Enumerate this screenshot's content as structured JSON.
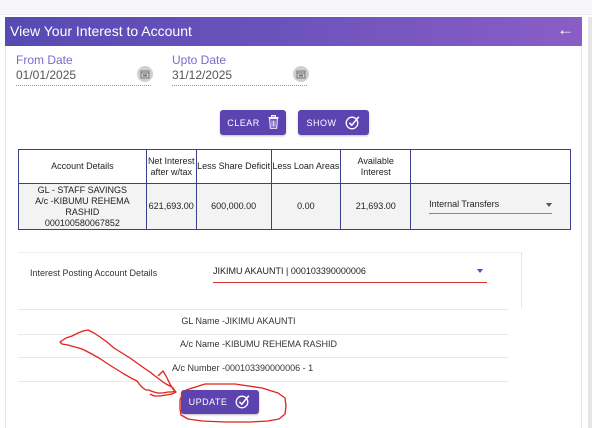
{
  "header": {
    "title": "View Your Interest to Account",
    "back_icon": "arrow-left-icon"
  },
  "filters": {
    "from_label": "From Date",
    "from_value": "01/01/2025",
    "upto_label": "Upto Date",
    "upto_value": "31/12/2025"
  },
  "actions": {
    "clear_label": "CLEAR",
    "show_label": "SHOW",
    "update_label": "UPDATE"
  },
  "table": {
    "headers": [
      "Account Details",
      "Net Interest after w/tax",
      "Less Share Deficit",
      "Less Loan Areas",
      "Available Interest",
      ""
    ],
    "row": {
      "account_line1": "GL - STAFF SAVINGS",
      "account_line2": "A/c -KIBUMU REHEMA RASHID",
      "account_line3": "000100580067852",
      "net_interest": "621,693.00",
      "share_deficit": "600,000.00",
      "loan_areas": "0.00",
      "available_interest": "21,693.00",
      "transfer_type": "Internal Transfers"
    }
  },
  "posting": {
    "label": "Interest Posting Account Details",
    "selected": "JIKIMU AKAUNTI | 000103390000006"
  },
  "details": {
    "gl_name_label": "GL Name -",
    "gl_name_value": "JIKIMU AKAUNTI",
    "ac_name_label": "A/c Name -",
    "ac_name_value": "KIBUMU REHEMA RASHID",
    "ac_number_label": "A/c Number -",
    "ac_number_value": "000103390000006 - 1"
  },
  "colors": {
    "primary": "#5c43b0",
    "header_start": "#574ab2",
    "header_end": "#8b5dc6",
    "annotation": "#e0231b"
  }
}
